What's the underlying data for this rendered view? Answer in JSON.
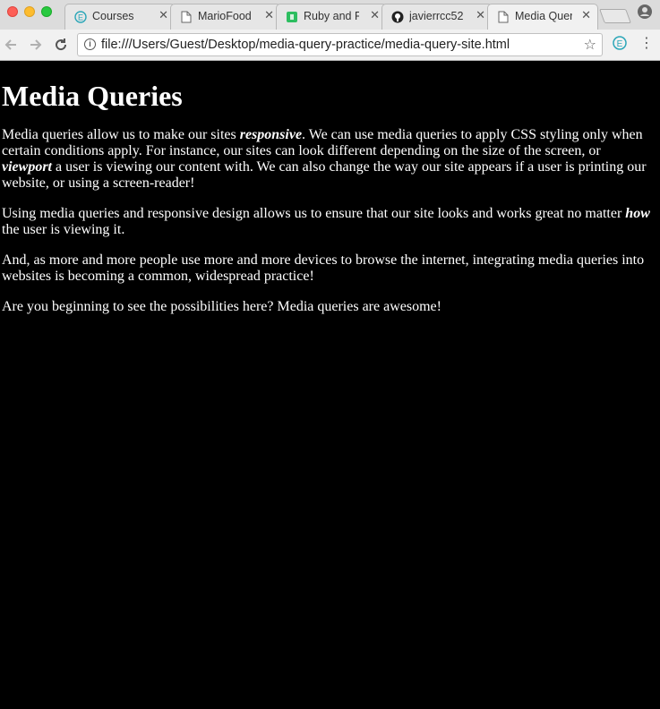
{
  "browser": {
    "tabs": [
      {
        "title": "Courses",
        "icon": "educative-icon",
        "active": false
      },
      {
        "title": "MarioFood",
        "icon": "page-icon",
        "active": false
      },
      {
        "title": "Ruby and R",
        "icon": "evernote-icon",
        "active": false
      },
      {
        "title": "javierrcc52",
        "icon": "github-icon",
        "active": false
      },
      {
        "title": "Media Quer",
        "icon": "page-icon",
        "active": true
      }
    ],
    "close_glyph": "✕",
    "address_bar": {
      "url": "file:///Users/Guest/Desktop/media-query-practice/media-query-site.html"
    }
  },
  "page": {
    "heading": "Media Queries",
    "p1": {
      "a": "Media queries allow us to make our sites ",
      "em1": "responsive",
      "b": ". We can use media queries to apply CSS styling only when certain conditions apply. For instance, our sites can look different depending on the size of the screen, or ",
      "em2": "viewport",
      "c": " a user is viewing our content with. We can also change the way our site appears if a user is printing our website, or using a screen-reader!"
    },
    "p2": {
      "a": "Using media queries and responsive design allows us to ensure that our site looks and works great no matter ",
      "em1": "how",
      "b": " the user is viewing it."
    },
    "p3": "And, as more and more people use more and more devices to browse the internet, integrating media queries into websites is becoming a common, widespread practice!",
    "p4": "Are you beginning to see the possibilities here? Media queries are awesome!"
  }
}
